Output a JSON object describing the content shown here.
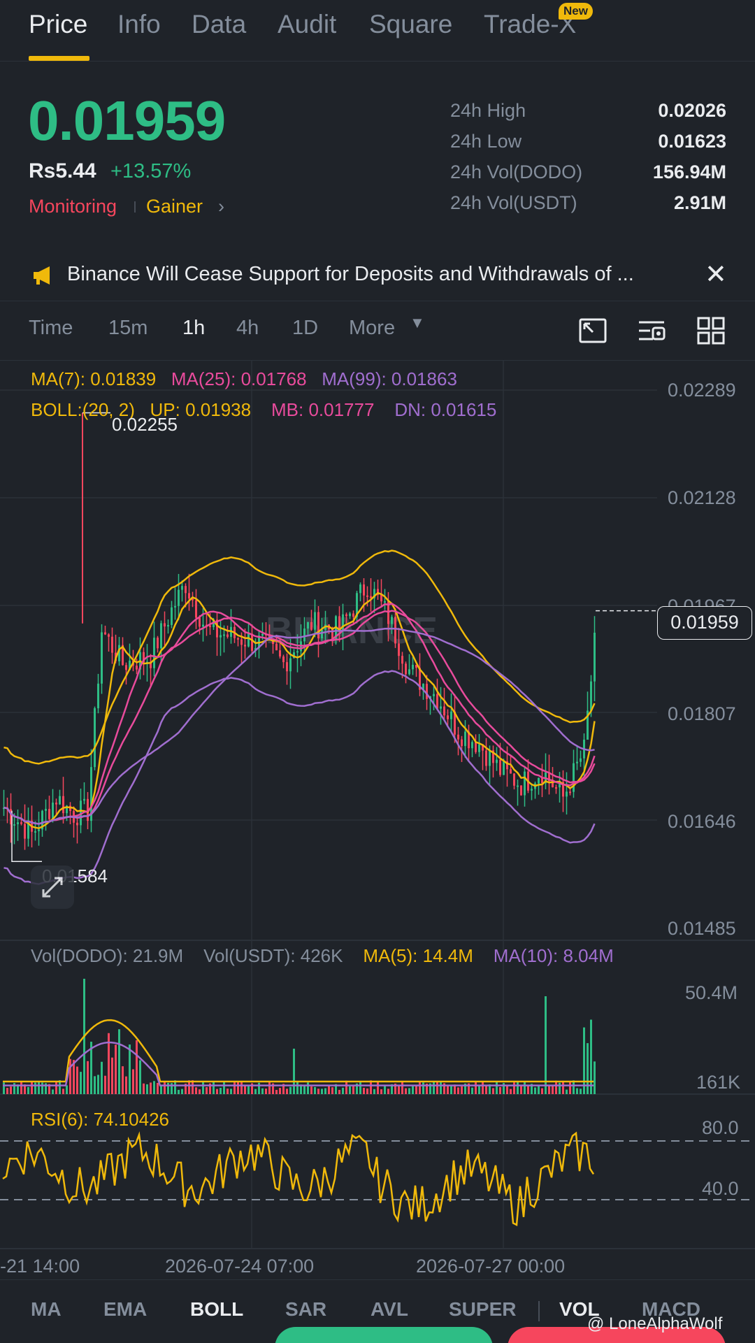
{
  "tabs": [
    {
      "label": "Price",
      "active": true
    },
    {
      "label": "Info"
    },
    {
      "label": "Data"
    },
    {
      "label": "Audit"
    },
    {
      "label": "Square"
    },
    {
      "label": "Trade-X",
      "badge": "New"
    }
  ],
  "ticker": {
    "price": "0.01959",
    "fiat": "Rs5.44",
    "change": "+13.57%",
    "tag_monitoring": "Monitoring",
    "tag_gainer": "Gainer"
  },
  "stats": [
    {
      "label": "24h High",
      "value": "0.02026"
    },
    {
      "label": "24h Low",
      "value": "0.01623"
    },
    {
      "label": "24h Vol(DODO)",
      "value": "156.94M"
    },
    {
      "label": "24h Vol(USDT)",
      "value": "2.91M"
    }
  ],
  "announcement": {
    "text": "Binance Will Cease Support for Deposits and Withdrawals of ..."
  },
  "intervals": {
    "items": [
      "Time",
      "15m",
      "1h",
      "4h",
      "1D"
    ],
    "active": "1h",
    "more": "More"
  },
  "chart": {
    "watermark": "BINANCE",
    "ma_legend": {
      "ma7": "MA(7): 0.01839",
      "ma25": "MA(25): 0.01768",
      "ma99": "MA(99): 0.01863"
    },
    "boll_legend": {
      "boll": "BOLL:(20, 2)",
      "up": "UP: 0.01938",
      "mb": "MB: 0.01777",
      "dn": "DN: 0.01615"
    },
    "price_axis": [
      "0.02289",
      "0.02128",
      "0.01967",
      "0.01807",
      "0.01646",
      "0.01485"
    ],
    "current_price": "0.01959",
    "high_label": "0.02255",
    "low_label": "0.01584",
    "vol_legend": {
      "dodo": "Vol(DODO): 21.9M",
      "usdt": "Vol(USDT): 426K",
      "ma5": "MA(5): 14.4M",
      "ma10": "MA(10): 8.04M"
    },
    "vol_axis": [
      "50.4M",
      "161K"
    ],
    "rsi_legend": "RSI(6): 74.10426",
    "rsi_axis": [
      "80.0",
      "40.0"
    ],
    "x_labels": [
      "-21 14:00",
      "2026-07-24 07:00",
      "2026-07-27 00:00"
    ]
  },
  "chart_data": {
    "type": "candlestick",
    "y_range": [
      0.01485,
      0.02289
    ],
    "high": 0.02255,
    "low": 0.01584,
    "last": 0.01959,
    "vol_range": [
      "161K",
      "50.4M"
    ],
    "rsi_levels": [
      80,
      40
    ],
    "x_labels": [
      "-21 14:00",
      "2026-07-24 07:00",
      "2026-07-27 00:00"
    ]
  },
  "indicators": {
    "items": [
      "MA",
      "EMA",
      "BOLL",
      "SAR",
      "AVL",
      "SUPER",
      "VOL",
      "MACD"
    ],
    "active": [
      "BOLL",
      "VOL"
    ]
  },
  "watermark_user": "@ LoneAlphaWolf",
  "colors": {
    "up": "#2ebd85",
    "down": "#f6465d",
    "accent": "#f0b90b",
    "purple": "#a06ecf",
    "pink": "#e84b9c"
  }
}
